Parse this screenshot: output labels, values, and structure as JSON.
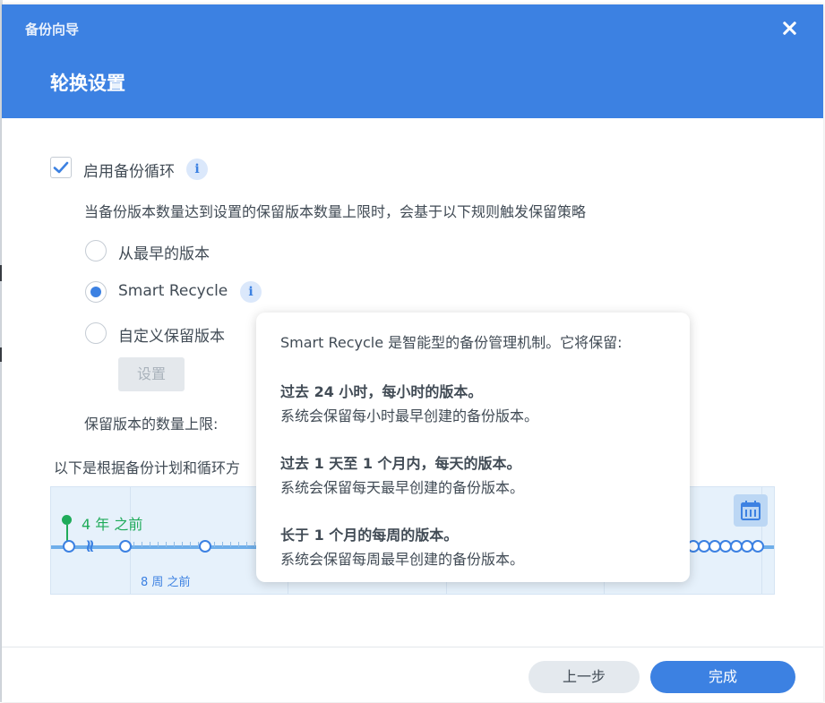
{
  "window": {
    "title": "备份向导",
    "step_title": "轮换设置"
  },
  "settings": {
    "enable_label": "启用备份循环",
    "enable_checked": true,
    "description": "当备份版本数量达到设置的保留版本数量上限时，会基于以下规则触发保留策略",
    "options": [
      {
        "label": "从最早的版本",
        "selected": false
      },
      {
        "label": "Smart Recycle",
        "selected": true
      },
      {
        "label": "自定义保留版本",
        "selected": false
      }
    ],
    "settings_button": "设置",
    "limit_label": "保留版本的数量上限:",
    "below_label": "以下是根据备份计划和循环方"
  },
  "timeline": {
    "years_label": "4 年 之前",
    "weeks_label": "8 周 之前"
  },
  "tooltip": {
    "intro": "Smart Recycle 是智能型的备份管理机制。它将保留:",
    "rules": [
      {
        "title": "过去 24 小时，每小时的版本。",
        "detail": "系统会保留每小时最早创建的备份版本。"
      },
      {
        "title": "过去 1 天至 1 个月内，每天的版本。",
        "detail": "系统会保留每天最早创建的备份版本。"
      },
      {
        "title": "长于 1 个月的每周的版本。",
        "detail": "系统会保留每周最早创建的备份版本。"
      }
    ]
  },
  "footer": {
    "back": "上一步",
    "finish": "完成"
  },
  "icons": {
    "close": "close-icon",
    "info": "info-icon",
    "check": "checkmark-icon",
    "calendar": "calendar-icon"
  },
  "colors": {
    "accent": "#3c81e2",
    "green": "#1fab5a"
  }
}
